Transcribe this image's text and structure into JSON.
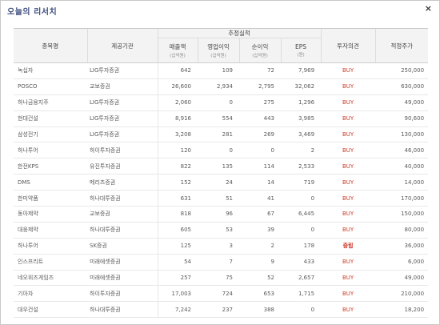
{
  "window": {
    "title": "오늘의 리서치",
    "close_label": "×"
  },
  "table": {
    "headers": {
      "name": "종목명",
      "broker": "제공기관",
      "group": "추정실적",
      "sales": "매출액",
      "sales_unit": "(십억원)",
      "op_income": "영업이익",
      "op_income_unit": "(십억원)",
      "net_income": "순이익",
      "net_income_unit": "(십억원)",
      "eps": "EPS",
      "eps_unit": "(원)",
      "opinion": "투자의견",
      "target": "적정주가"
    },
    "rows": [
      {
        "name": "녹십자",
        "broker": "LIG투자증권",
        "sales": "642",
        "op": "109",
        "net": "72",
        "eps": "7,969",
        "opinion": "BUY",
        "target": "250,000"
      },
      {
        "name": "POSCO",
        "broker": "교보증권",
        "sales": "26,600",
        "op": "2,934",
        "net": "2,795",
        "eps": "32,062",
        "opinion": "BUY",
        "target": "630,000"
      },
      {
        "name": "하나금융지주",
        "broker": "LIG투자증권",
        "sales": "2,060",
        "op": "0",
        "net": "275",
        "eps": "1,296",
        "opinion": "BUY",
        "target": "49,000"
      },
      {
        "name": "현대건설",
        "broker": "LIG투자증권",
        "sales": "8,916",
        "op": "554",
        "net": "443",
        "eps": "3,985",
        "opinion": "BUY",
        "target": "90,600"
      },
      {
        "name": "삼성전기",
        "broker": "LIG투자증권",
        "sales": "3,208",
        "op": "281",
        "net": "269",
        "eps": "3,469",
        "opinion": "BUY",
        "target": "130,000"
      },
      {
        "name": "하나투어",
        "broker": "하이투자증권",
        "sales": "120",
        "op": "0",
        "net": "0",
        "eps": "2",
        "opinion": "BUY",
        "target": "46,000"
      },
      {
        "name": "한전KPS",
        "broker": "유진투자증권",
        "sales": "822",
        "op": "135",
        "net": "114",
        "eps": "2,533",
        "opinion": "BUY",
        "target": "40,000"
      },
      {
        "name": "DMS",
        "broker": "메리츠증권",
        "sales": "152",
        "op": "24",
        "net": "14",
        "eps": "719",
        "opinion": "BUY",
        "target": "14,000"
      },
      {
        "name": "한미약품",
        "broker": "하나대투증권",
        "sales": "631",
        "op": "51",
        "net": "41",
        "eps": "0",
        "opinion": "BUY",
        "target": "170,000"
      },
      {
        "name": "동아제약",
        "broker": "교보증권",
        "sales": "818",
        "op": "96",
        "net": "67",
        "eps": "6,445",
        "opinion": "BUY",
        "target": "150,000"
      },
      {
        "name": "대웅제약",
        "broker": "하나대투증권",
        "sales": "605",
        "op": "53",
        "net": "39",
        "eps": "0",
        "opinion": "BUY",
        "target": "80,000"
      },
      {
        "name": "하나투어",
        "broker": "SK증권",
        "sales": "125",
        "op": "3",
        "net": "2",
        "eps": "178",
        "opinion": "중립",
        "target": "36,000"
      },
      {
        "name": "인스프리트",
        "broker": "미래에셋증권",
        "sales": "54",
        "op": "7",
        "net": "9",
        "eps": "433",
        "opinion": "BUY",
        "target": "6,000"
      },
      {
        "name": "네오위즈게임즈",
        "broker": "미래에셋증권",
        "sales": "257",
        "op": "75",
        "net": "52",
        "eps": "2,657",
        "opinion": "BUY",
        "target": "49,000"
      },
      {
        "name": "기아차",
        "broker": "하이투자증권",
        "sales": "17,003",
        "op": "724",
        "net": "653",
        "eps": "1,715",
        "opinion": "BUY",
        "target": "210,000"
      },
      {
        "name": "대우건설",
        "broker": "하나대투증권",
        "sales": "7,242",
        "op": "237",
        "net": "388",
        "eps": "0",
        "opinion": "BUY",
        "target": "18,200"
      }
    ]
  },
  "colors": {
    "buy": "#d23c2a",
    "hold": "#cc2b1e",
    "title": "#3e4f80"
  }
}
